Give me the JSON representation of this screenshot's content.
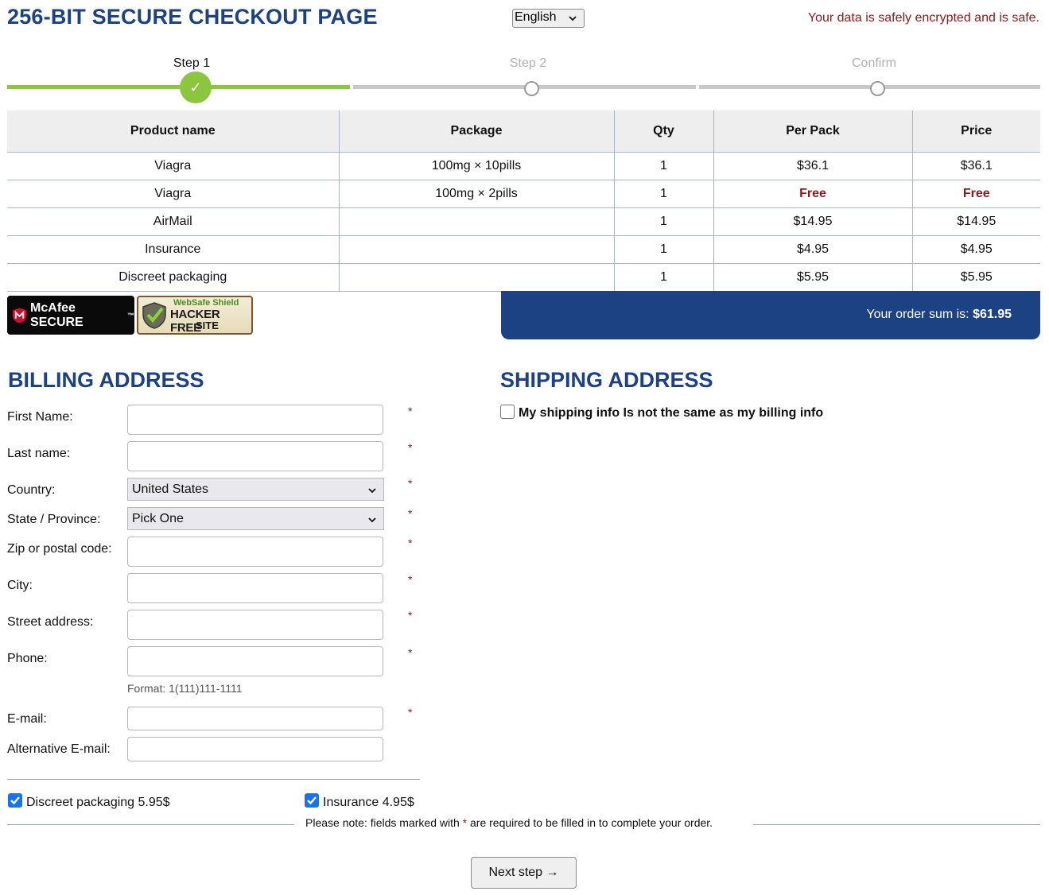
{
  "header": {
    "title": "256-BIT SECURE CHECKOUT PAGE",
    "language": "English",
    "safe_note": "Your data is safely encrypted and is safe."
  },
  "steps": [
    {
      "label": "Step 1",
      "state": "done"
    },
    {
      "label": "Step 2",
      "state": "pending"
    },
    {
      "label": "Confirm",
      "state": "pending"
    }
  ],
  "table": {
    "headers": [
      "Product name",
      "Package",
      "Qty",
      "Per Pack",
      "Price"
    ],
    "rows": [
      {
        "product": "Viagra",
        "package": "100mg × 10pills",
        "qty": "1",
        "per_pack": "$36.1",
        "price": "$36.1"
      },
      {
        "product": "Viagra",
        "package": "100mg × 2pills",
        "qty": "1",
        "per_pack": "Free",
        "price": "Free"
      },
      {
        "product": "AirMail",
        "package": "",
        "qty": "1",
        "per_pack": "$14.95",
        "price": "$14.95"
      },
      {
        "product": "Insurance",
        "package": "",
        "qty": "1",
        "per_pack": "$4.95",
        "price": "$4.95"
      },
      {
        "product": "Discreet packaging",
        "package": "",
        "qty": "1",
        "per_pack": "$5.95",
        "price": "$5.95"
      }
    ]
  },
  "badges": {
    "mcafee": "McAfee SECURE",
    "mcafee_tm": "™",
    "websafe": "WebSafe Shield",
    "hacker_free": "HACKER FREE",
    "site": "SITE"
  },
  "order_sum": {
    "label": "Your order sum is: ",
    "value": "$61.95"
  },
  "billing": {
    "title": "BILLING ADDRESS",
    "first_name": "First Name:",
    "last_name": "Last name:",
    "country": "Country:",
    "country_value": "United States",
    "state": "State / Province:",
    "state_value": "Pick One",
    "zip": "Zip or postal code:",
    "city": "City:",
    "street": "Street address:",
    "phone": "Phone:",
    "phone_format": "Format: 1(111)111-1111",
    "email": "E-mail:",
    "alt_email": "Alternative E-mail:",
    "required_mark": "*"
  },
  "shipping": {
    "title": "SHIPPING ADDRESS",
    "different_label": "My shipping info Is not the same as my billing info"
  },
  "options": {
    "discreet": "Discreet packaging 5.95$",
    "insurance": "Insurance 4.95$"
  },
  "note": {
    "before": "Please note: fields marked with ",
    "star": "*",
    "after": " are required to be filled in to complete your order."
  },
  "next_button": "Next step →",
  "colors": {
    "brand_blue": "#1d4283",
    "step_green": "#8bc63e",
    "alert_red": "#8b1a1a",
    "checkbox_blue": "#1a73e8"
  }
}
